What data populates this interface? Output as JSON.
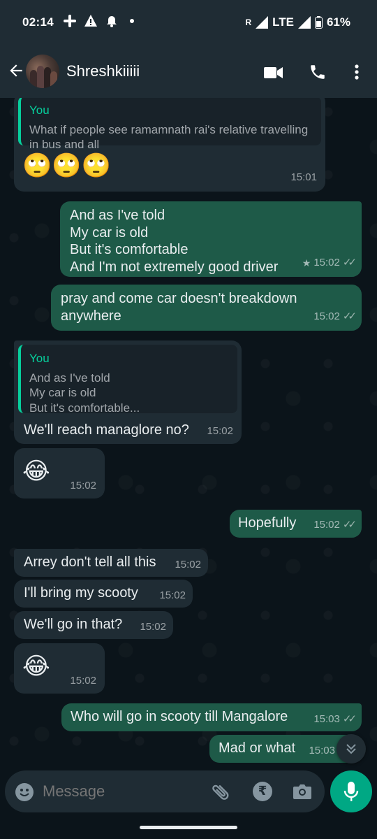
{
  "status_bar": {
    "time": "02:14",
    "network": "LTE",
    "battery": "61%"
  },
  "header": {
    "contact_name": "Shreshkiiiii"
  },
  "messages": [
    {
      "dir": "in",
      "quote_author": "You",
      "quote_text": "What if people see ramamnath rai's relative travelling in bus and all",
      "text": "🙄🙄🙄",
      "time": "15:01"
    },
    {
      "dir": "out",
      "lines": [
        "And as I've told",
        "My car is old",
        "But it's comfortable",
        "And I'm not extremely good driver"
      ],
      "starred": true,
      "time": "15:02"
    },
    {
      "dir": "out",
      "lines": [
        "pray and come car doesn't breakdown",
        "anywhere"
      ],
      "time": "15:02"
    },
    {
      "dir": "in",
      "quote_author": "You",
      "quote_lines": [
        "And as I've told",
        "My car is old",
        "But it's comfortable..."
      ],
      "text": "We'll reach managlore no?",
      "time": "15:02"
    },
    {
      "dir": "in",
      "text": "😂",
      "time": "15:02"
    },
    {
      "dir": "out",
      "text": "Hopefully",
      "time": "15:02"
    },
    {
      "dir": "in",
      "text": "Arrey don't tell all this",
      "time": "15:02"
    },
    {
      "dir": "in",
      "text": "I'll bring my scooty",
      "time": "15:02"
    },
    {
      "dir": "in",
      "text": "We'll go in that?",
      "time": "15:02"
    },
    {
      "dir": "in",
      "text": "😂",
      "time": "15:02"
    },
    {
      "dir": "out",
      "text": "Who will go in scooty till Mangalore",
      "time": "15:03"
    },
    {
      "dir": "out",
      "text": "Mad or what",
      "time": "15:03"
    }
  ],
  "composer": {
    "placeholder": "Message"
  },
  "icons": {
    "status": [
      "slack-icon",
      "warning-icon",
      "alarm-icon",
      "dot-icon",
      "signal-icon",
      "battery-icon"
    ],
    "header": [
      "back-arrow-icon",
      "video-call-icon",
      "voice-call-icon",
      "more-vert-icon"
    ],
    "composer": [
      "emoji-icon",
      "attach-icon",
      "rupee-payment-icon",
      "camera-icon",
      "mic-icon"
    ]
  },
  "colors": {
    "outgoing": "#1e5a48",
    "incoming": "#1f2c34",
    "accent": "#00a884",
    "quote_bar": "#06cf9c"
  }
}
